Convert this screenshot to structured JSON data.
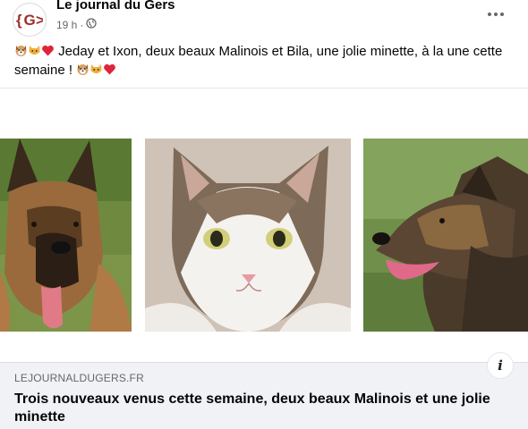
{
  "post": {
    "author": "Le journal du Gers",
    "time": "19 h",
    "separator": "·",
    "privacy_icon": "globe-icon",
    "options_icon": "more-options-icon",
    "text_main": " Jeday et Ixon, deux beaux Malinois et Bila, une jolie minette, à la une cette semaine ! ",
    "emojis_start": [
      "dog-face-emoji",
      "cat-face-emoji",
      "red-heart-emoji"
    ],
    "emojis_end": [
      "dog-face-emoji",
      "cat-face-emoji",
      "red-heart-emoji"
    ]
  },
  "logo": {
    "text": "G"
  },
  "media": {
    "photos": [
      {
        "name": "malinois-dog-photo",
        "description_icon": "dog-photo"
      },
      {
        "name": "cat-photo",
        "description_icon": "cat-photo"
      },
      {
        "name": "brindle-dog-photo",
        "description_icon": "dog-photo"
      }
    ]
  },
  "link_preview": {
    "domain": "LEJOURNALDUGERS.FR",
    "title": "Trois nouveaux venus cette semaine, deux beaux Malinois et une jolie minette",
    "info_label": "i"
  },
  "colors": {
    "brand": "#9c2f2a",
    "secondary_text": "#65676b",
    "link_bg": "#f0f2f5"
  }
}
